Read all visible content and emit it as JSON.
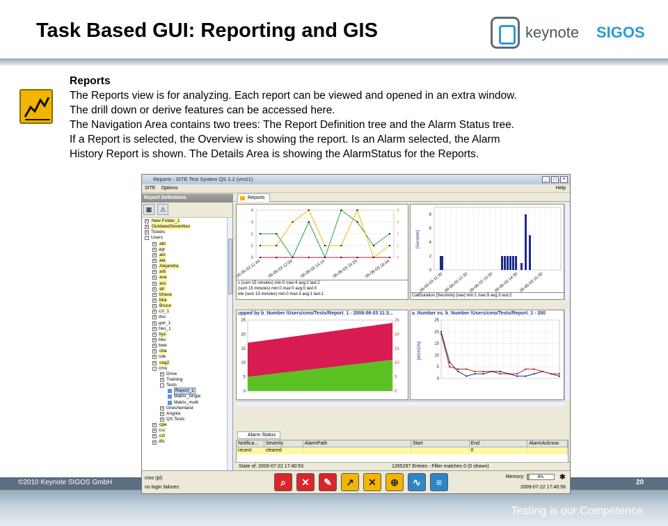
{
  "slide": {
    "title": "Task Based GUI: Reporting and GIS",
    "logo_text": "keynote",
    "logo_brand": "SIGOS",
    "copyright": "©2010 Keynote SIGOS GmbH",
    "page_number": "20",
    "tagline": "Testing is our Competence"
  },
  "description": {
    "heading": "Reports",
    "lines": [
      "The Reports view is for analyzing. Each report can be viewed and opened in an extra window.",
      "The drill down or derive features can be accessed here.",
      "The Navigation Area contains two trees: The Report Definition tree and the Alarm Status tree.",
      "If a Report is selected, the Overview is showing the report. Is an Alarm selected, the Alarm",
      "History Report is shown. The Details Area is showing the AlarmStatus for the Reports."
    ]
  },
  "app": {
    "window_title": "Reports - SITE Test System QS 2.2 (vm21)",
    "menu": [
      "SITE",
      "Options"
    ],
    "help": "Help",
    "left_pane_title": "Report Definitions",
    "tree": [
      {
        "label": "New Folder_1",
        "level": 1,
        "exp": "+",
        "hl": true
      },
      {
        "label": "OutdatedSeverities",
        "level": 1,
        "exp": "+",
        "hl": true
      },
      {
        "label": "Tickets",
        "level": 1,
        "exp": "+",
        "hl": false
      },
      {
        "label": "Users",
        "level": 1,
        "exp": "-",
        "hl": false
      },
      {
        "label": "abr",
        "level": 2,
        "exp": "+",
        "hl": true
      },
      {
        "label": "agr",
        "level": 2,
        "exp": "+",
        "hl": false
      },
      {
        "label": "ani",
        "level": 2,
        "exp": "+",
        "hl": true
      },
      {
        "label": "ala",
        "level": 2,
        "exp": "+",
        "hl": true
      },
      {
        "label": "Alejandra",
        "level": 2,
        "exp": "+",
        "hl": true
      },
      {
        "label": "arb",
        "level": 2,
        "exp": "+",
        "hl": true
      },
      {
        "label": "asa",
        "level": 2,
        "exp": "+",
        "hl": true
      },
      {
        "label": "asc",
        "level": 2,
        "exp": "+",
        "hl": true
      },
      {
        "label": "atr",
        "level": 2,
        "exp": "+",
        "hl": true
      },
      {
        "label": "bhava",
        "level": 2,
        "exp": "+",
        "hl": true
      },
      {
        "label": "bka",
        "level": 2,
        "exp": "+",
        "hl": true
      },
      {
        "label": "Bruce",
        "level": 2,
        "exp": "+",
        "hl": true
      },
      {
        "label": "czi_1",
        "level": 2,
        "exp": "+",
        "hl": false
      },
      {
        "label": "dsc",
        "level": 2,
        "exp": "+",
        "hl": false
      },
      {
        "label": "gwi_1",
        "level": 2,
        "exp": "+",
        "hl": false
      },
      {
        "label": "hko_1",
        "level": 2,
        "exp": "+",
        "hl": false
      },
      {
        "label": "kyc",
        "level": 2,
        "exp": "+",
        "hl": true
      },
      {
        "label": "bko",
        "level": 2,
        "exp": "+",
        "hl": false
      },
      {
        "label": "bwe",
        "level": 2,
        "exp": "+",
        "hl": false
      },
      {
        "label": "cba",
        "level": 2,
        "exp": "+",
        "hl": true
      },
      {
        "label": "cde",
        "level": 2,
        "exp": "+",
        "hl": false
      },
      {
        "label": "ceg2",
        "level": 2,
        "exp": "+",
        "hl": true
      },
      {
        "label": "cmo",
        "level": 2,
        "exp": "-",
        "hl": false
      },
      {
        "label": "Drive",
        "level": 3,
        "exp": "+",
        "hl": false
      },
      {
        "label": "Training",
        "level": 3,
        "exp": "+",
        "hl": false
      },
      {
        "label": "Tests",
        "level": 3,
        "exp": "-",
        "hl": false
      },
      {
        "label": "Report_1",
        "level": 4,
        "exp": "leaf",
        "hl": false,
        "sel": true
      },
      {
        "label": "Matrix_single",
        "level": 4,
        "exp": "leaf",
        "hl": false
      },
      {
        "label": "Matrix_multi",
        "level": 4,
        "exp": "leaf",
        "hl": false
      },
      {
        "label": "Griechenland",
        "level": 3,
        "exp": "+",
        "hl": false
      },
      {
        "label": "Angola",
        "level": 3,
        "exp": "+",
        "hl": false
      },
      {
        "label": "QS Tests",
        "level": 3,
        "exp": "+",
        "hl": false
      },
      {
        "label": "cpe",
        "level": 2,
        "exp": "+",
        "hl": true
      },
      {
        "label": "csc",
        "level": 2,
        "exp": "+",
        "hl": false
      },
      {
        "label": "czi",
        "level": 2,
        "exp": "+",
        "hl": true
      },
      {
        "label": "dts",
        "level": 2,
        "exp": "+",
        "hl": false
      }
    ],
    "reports_tab": "Reports",
    "chart1_legend": [
      "s (sum 15 minutes)  min:0  max:4  avg:2  last:2",
      "(sum 15 minutes)  min:0  max:0  avg:0  last:0",
      "ete (sum 15 minutes)  min:0  max:3  avg:1  last:1"
    ],
    "chart2_legend": "CallDuration [Seconds] (raw)  min:1  max:9  avg:3  last:2",
    "chart2_ylabel": "[Seconds]",
    "chart3_title": "upped by  b_Number       /Users/cmo/Tests/Report_1 - 2008-06-03 11:3...",
    "chart4_title": "a_Number vs. b_Number      /Users/cmo/Tests/Report_1 - 200",
    "chart4_ylabel": "[MSISDN]",
    "alarm": {
      "tab": "Alarm Status",
      "headers": [
        "Notifica...",
        "Severity",
        "AlarmPath",
        "Start",
        "End",
        "AlarmAcknow"
      ],
      "row": [
        "recent",
        "cleared",
        "",
        "",
        "0",
        ""
      ]
    },
    "status_left": "State of: 2009-07-22 17:40:53",
    "status_right": "1265297 Entries - Filter matches 0 (0 shown)",
    "user": "cmo (pl)",
    "login": "no login failures",
    "memory_label": "Memory:",
    "memory_value": "8%",
    "datetime": "2009-07-22 17:40:56"
  },
  "chart_data": [
    {
      "type": "line",
      "x": [
        "06-06-03 11:44",
        "06-06-03 12:59",
        "06-06-03 14:14",
        "06-06-03 15:29",
        "06-06-03 16:44"
      ],
      "series": [
        {
          "values": [
            2,
            2,
            0,
            3,
            0,
            4,
            3,
            1,
            2
          ]
        },
        {
          "values": [
            1,
            1,
            3,
            4,
            1,
            1,
            4,
            0,
            1
          ]
        },
        {
          "values": [
            0,
            0,
            0,
            0,
            0,
            0,
            0,
            0,
            0
          ]
        }
      ],
      "ylim": [
        0,
        4
      ],
      "colors": [
        "#1aa34a",
        "#f2b600",
        "#c0182a"
      ]
    },
    {
      "type": "bar",
      "x": [
        "06-06-03 11:30",
        "06-06-03 12:30",
        "06-06-03 13:30",
        "06-06-03 14:30",
        "06-06-03 15:30"
      ],
      "values": [
        2,
        2,
        2,
        2,
        2,
        2,
        2,
        2,
        1,
        8,
        5
      ],
      "ylabel": "[Seconds]",
      "ylim": [
        0,
        9
      ]
    },
    {
      "type": "area",
      "series": [
        {
          "values": [
            5,
            11
          ]
        },
        {
          "values": [
            17,
            24
          ]
        }
      ],
      "ylim": [
        0,
        25
      ],
      "colors": [
        "#5cc223",
        "#d81b50"
      ]
    },
    {
      "type": "line",
      "series": [
        {
          "values": [
            20,
            7,
            3,
            1,
            2,
            2,
            3,
            3,
            2,
            1,
            1,
            2,
            3,
            2,
            1
          ]
        },
        {
          "values": [
            19,
            5,
            4,
            4,
            3,
            3,
            3,
            2,
            2,
            2,
            4,
            4,
            3,
            2,
            2
          ]
        }
      ],
      "ylim": [
        0,
        25
      ],
      "ylabel": "[MSISDN]",
      "colors": [
        "#1f2a88",
        "#b22222"
      ]
    }
  ]
}
